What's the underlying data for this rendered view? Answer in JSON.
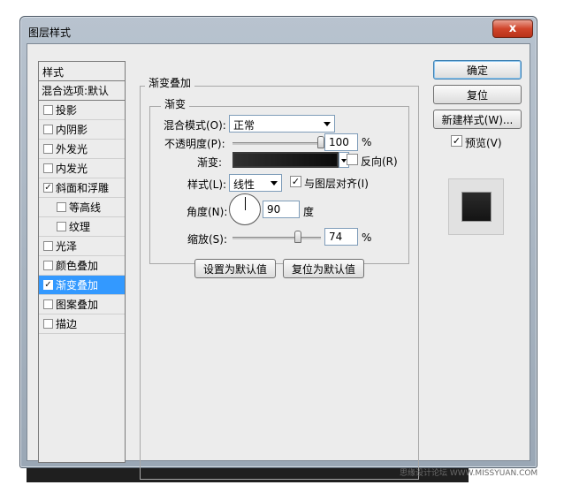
{
  "window": {
    "title": "图层样式",
    "close_symbol": "x"
  },
  "style_list": {
    "header": "样式",
    "blend_options": "混合选项:默认",
    "items": [
      {
        "label": "投影",
        "checked": false,
        "sub": false,
        "selected": false
      },
      {
        "label": "内阴影",
        "checked": false,
        "sub": false,
        "selected": false
      },
      {
        "label": "外发光",
        "checked": false,
        "sub": false,
        "selected": false
      },
      {
        "label": "内发光",
        "checked": false,
        "sub": false,
        "selected": false
      },
      {
        "label": "斜面和浮雕",
        "checked": true,
        "sub": false,
        "selected": false
      },
      {
        "label": "等高线",
        "checked": false,
        "sub": true,
        "selected": false
      },
      {
        "label": "纹理",
        "checked": false,
        "sub": true,
        "selected": false
      },
      {
        "label": "光泽",
        "checked": false,
        "sub": false,
        "selected": false
      },
      {
        "label": "颜色叠加",
        "checked": false,
        "sub": false,
        "selected": false
      },
      {
        "label": "渐变叠加",
        "checked": true,
        "sub": false,
        "selected": true
      },
      {
        "label": "图案叠加",
        "checked": false,
        "sub": false,
        "selected": false
      },
      {
        "label": "描边",
        "checked": false,
        "sub": false,
        "selected": false
      }
    ]
  },
  "panel": {
    "outer_title": "渐变叠加",
    "inner_title": "渐变",
    "blend_mode_label": "混合模式(O):",
    "blend_mode_value": "正常",
    "opacity_label": "不透明度(P):",
    "opacity_value": "100",
    "opacity_unit": "%",
    "opacity_level_percent": 100,
    "gradient_label": "渐变:",
    "reverse_label": "反向(R)",
    "reverse_checked": false,
    "style_label": "样式(L):",
    "style_value": "线性",
    "align_label": "与图层对齐(I)",
    "align_checked": true,
    "angle_label": "角度(N):",
    "angle_value": "90",
    "angle_unit": "度",
    "scale_label": "缩放(S):",
    "scale_value": "74",
    "scale_unit": "%",
    "scale_level_percent": 74,
    "make_default_label": "设置为默认值",
    "reset_default_label": "复位为默认值"
  },
  "right": {
    "ok_label": "确定",
    "reset_label": "复位",
    "new_style_label": "新建样式(W)...",
    "preview_label": "预览(V)",
    "preview_checked": true
  },
  "watermark": "思缘设计论坛 WWW.MISSYUAN.COM"
}
